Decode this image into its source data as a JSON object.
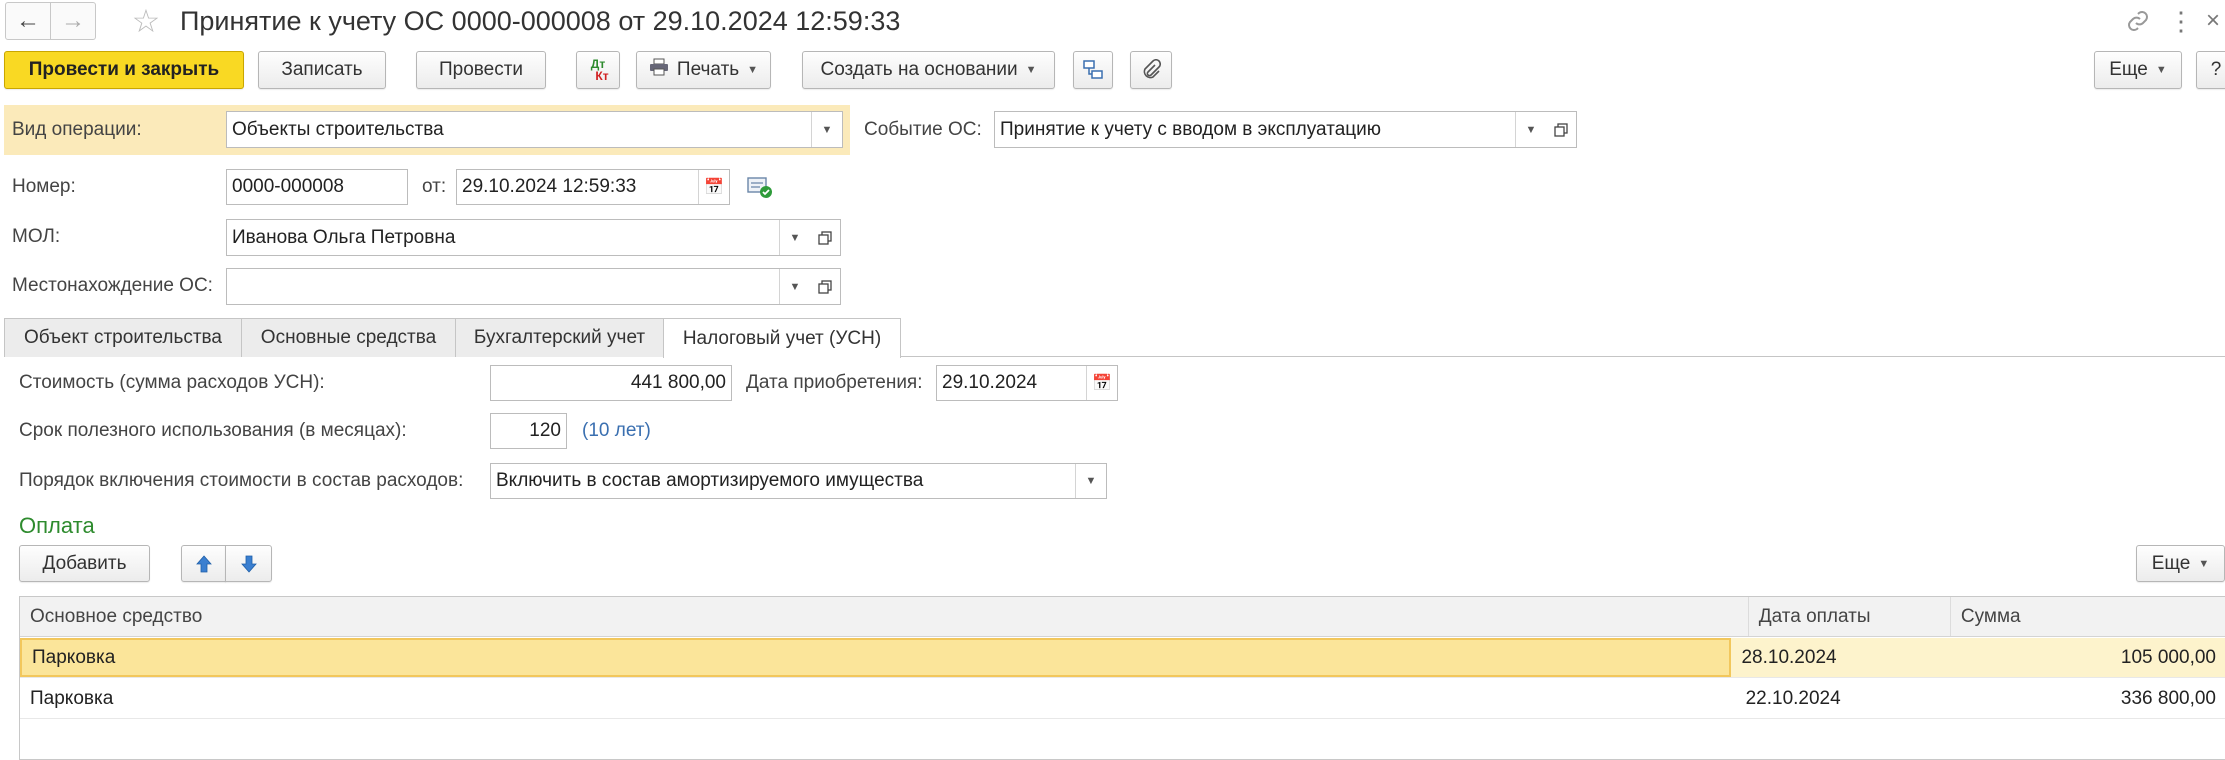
{
  "window": {
    "title": "Принятие к учету ОС 0000-000008 от 29.10.2024 12:59:33"
  },
  "toolbar": {
    "post_close": "Провести и закрыть",
    "save": "Записать",
    "post": "Провести",
    "dtkt_top": "Дт",
    "dtkt_bottom": "Кт",
    "print": "Печать",
    "create_based": "Создать на основании",
    "more": "Еще",
    "help": "?"
  },
  "form": {
    "operation_label": "Вид операции:",
    "operation_value": "Объекты строительства",
    "event_label": "Событие ОС:",
    "event_value": "Принятие к учету с вводом в эксплуатацию",
    "number_label": "Номер:",
    "number_value": "0000-000008",
    "from_label": "от:",
    "date_value": "29.10.2024 12:59:33",
    "mol_label": "МОЛ:",
    "mol_value": "Иванова Ольга Петровна",
    "location_label": "Местонахождение ОС:",
    "location_value": ""
  },
  "tabs": [
    {
      "label": "Объект строительства",
      "active": false
    },
    {
      "label": "Основные средства",
      "active": false
    },
    {
      "label": "Бухгалтерский учет",
      "active": false
    },
    {
      "label": "Налоговый учет (УСН)",
      "active": true
    }
  ],
  "tax": {
    "cost_label": "Стоимость (сумма расходов УСН):",
    "cost_value": "441 800,00",
    "acq_date_label": "Дата приобретения:",
    "acq_date_value": "29.10.2024",
    "life_label": "Срок полезного использования (в месяцах):",
    "life_value": "120",
    "life_hint": "(10 лет)",
    "order_label": "Порядок включения стоимости в состав расходов:",
    "order_value": "Включить в состав амортизируемого имущества"
  },
  "payment": {
    "section_title": "Оплата",
    "add_button": "Добавить",
    "more_button": "Еще",
    "columns": [
      "Основное средство",
      "Дата оплаты",
      "Сумма"
    ],
    "rows": [
      {
        "asset": "Парковка",
        "date": "28.10.2024",
        "sum": "105 000,00",
        "selected": true
      },
      {
        "asset": "Парковка",
        "date": "22.10.2024",
        "sum": "336 800,00",
        "selected": false
      }
    ]
  },
  "colors": {
    "accent_yellow": "#f9d923",
    "highlight_field_bg": "#fbeaba",
    "selected_row": "#fbe59a",
    "selected_row_other": "#fdf3cc",
    "section_green": "#2e8b2e",
    "link_blue": "#3a6fb0"
  }
}
